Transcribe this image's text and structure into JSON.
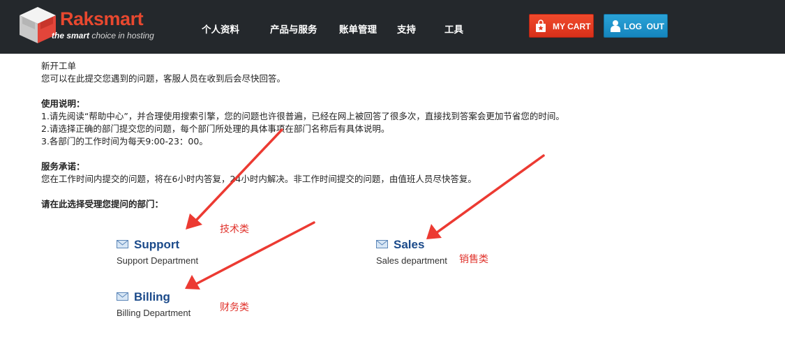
{
  "header": {
    "logo_word": "Raksmart",
    "logo_tag_bold": "the smart",
    "logo_tag_rest": " choice in hosting",
    "nav": [
      "个人资料",
      "产品与服务",
      "账单管理",
      "支持",
      "工具"
    ],
    "cart_label": "MY CART",
    "logout_label": "LOG  OUT"
  },
  "intro": {
    "title": "新开工单",
    "subtitle": "您可以在此提交您遇到的问题，客服人员在收到后会尽快回答。"
  },
  "usage": {
    "heading": "使用说明：",
    "items": [
      "1.请先阅读“帮助中心”，并合理使用搜索引擎，您的问题也许很普遍，已经在网上被回答了很多次，直接找到答案会更加节省您的时间。",
      "2.请选择正确的部门提交您的问题，每个部门所处理的具体事项在部门名称后有具体说明。",
      "3.各部门的工作时间为每天9:00-23：00。"
    ]
  },
  "promise": {
    "heading": "服务承诺：",
    "text": "您在工作时间内提交的问题，将在6小时内答复，24小时内解决。非工作时间提交的问题，由值班人员尽快答复。"
  },
  "select_prompt": "请在此选择受理您提问的部门：",
  "departments": [
    {
      "name": "Support",
      "desc": "Support Department",
      "annotation": "技术类"
    },
    {
      "name": "Sales",
      "desc": "Sales department",
      "annotation": "销售类"
    },
    {
      "name": "Billing",
      "desc": "Billing Department",
      "annotation": "财务类"
    }
  ],
  "colors": {
    "header_bg": "#24282c",
    "brand_red": "#e8482f",
    "dept_link": "#1b4a8a",
    "annotation_red": "#e0322b",
    "cart_button": "#e33b22",
    "logout_button": "#1f94cb"
  },
  "icons": {
    "logo": "cube-logo-icon",
    "cart": "shopping-bag-icon",
    "user": "user-icon",
    "department": "envelope-icon"
  }
}
